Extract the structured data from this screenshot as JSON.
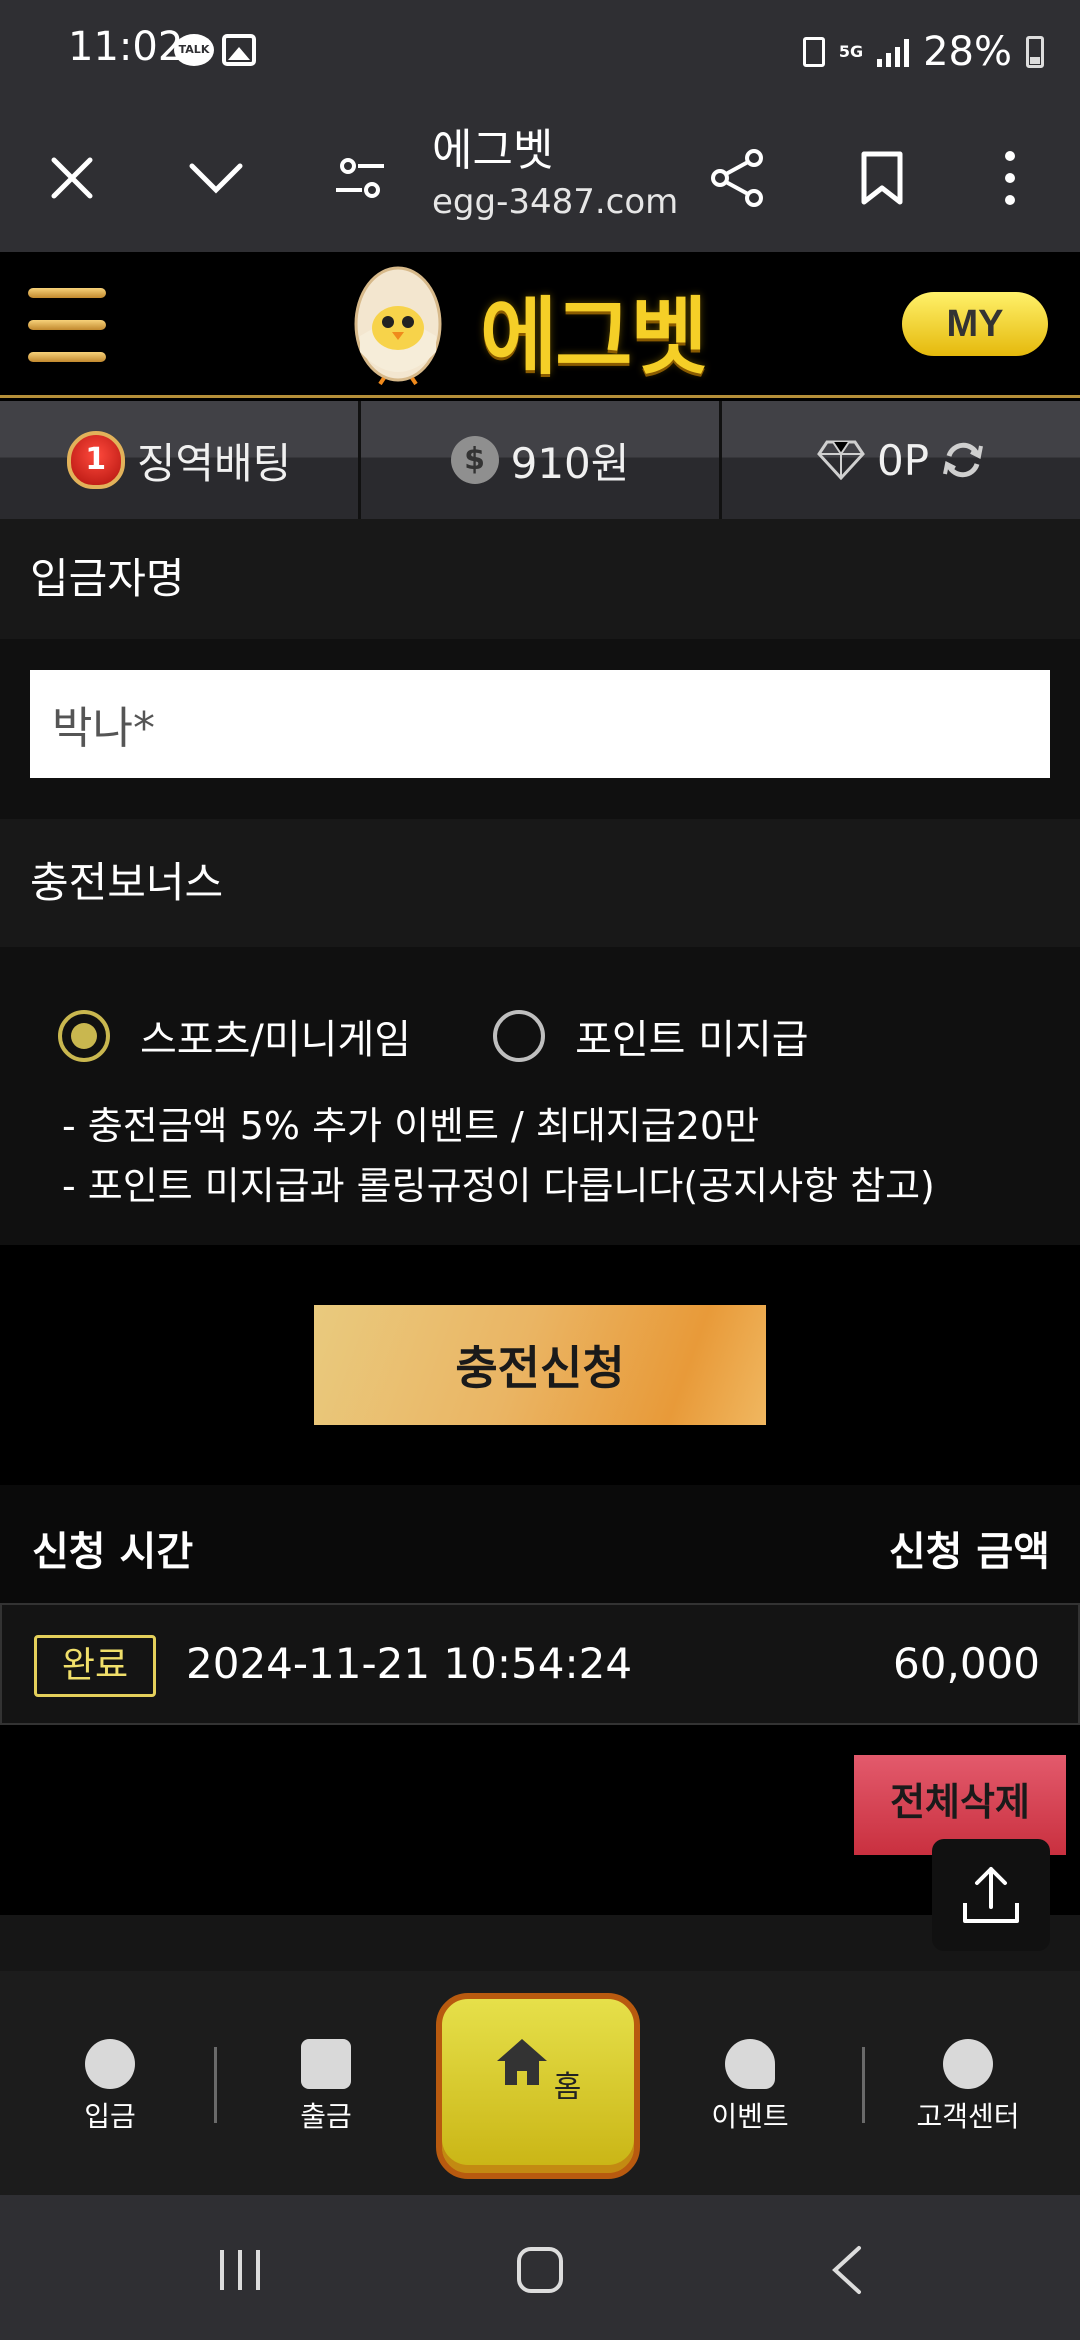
{
  "status_bar": {
    "time": "11:02",
    "talk_label": "TALK",
    "network": "5G",
    "battery": "28%"
  },
  "browser": {
    "site_title": "에그벳",
    "url": "egg-3487.com"
  },
  "header": {
    "logo_text": "에그벳",
    "my_label": "MY"
  },
  "info": {
    "level_badge": "1",
    "username": "징역배팅",
    "coin_symbol": "$",
    "balance": "910원",
    "points": "0P"
  },
  "form": {
    "depositor_label": "입금자명",
    "depositor_value": "박나*",
    "bonus_label": "충전보너스",
    "options": [
      {
        "label": "스포츠/미니게임",
        "selected": true
      },
      {
        "label": "포인트 미지급",
        "selected": false
      }
    ],
    "notes": [
      "- 충전금액 5% 추가 이벤트 / 최대지급20만",
      "- 포인트 미지급과 롤링규정이 다릅니다(공지사항 참고)"
    ],
    "submit_label": "충전신청"
  },
  "history": {
    "col_time": "신청 시간",
    "col_amount": "신청 금액",
    "rows": [
      {
        "status": "완료",
        "time": "2024-11-21 10:54:24",
        "amount": "60,000"
      }
    ],
    "delete_all_label": "전체삭제"
  },
  "bottom_nav": {
    "items": [
      "입금",
      "출금",
      "홈",
      "이벤트",
      "고객센터"
    ]
  },
  "colors": {
    "accent_gold": "#f5cf27",
    "selected_radio": "#c9b74f",
    "delete_red": "#d63a4b",
    "home_yellow": "#e6e04a"
  }
}
